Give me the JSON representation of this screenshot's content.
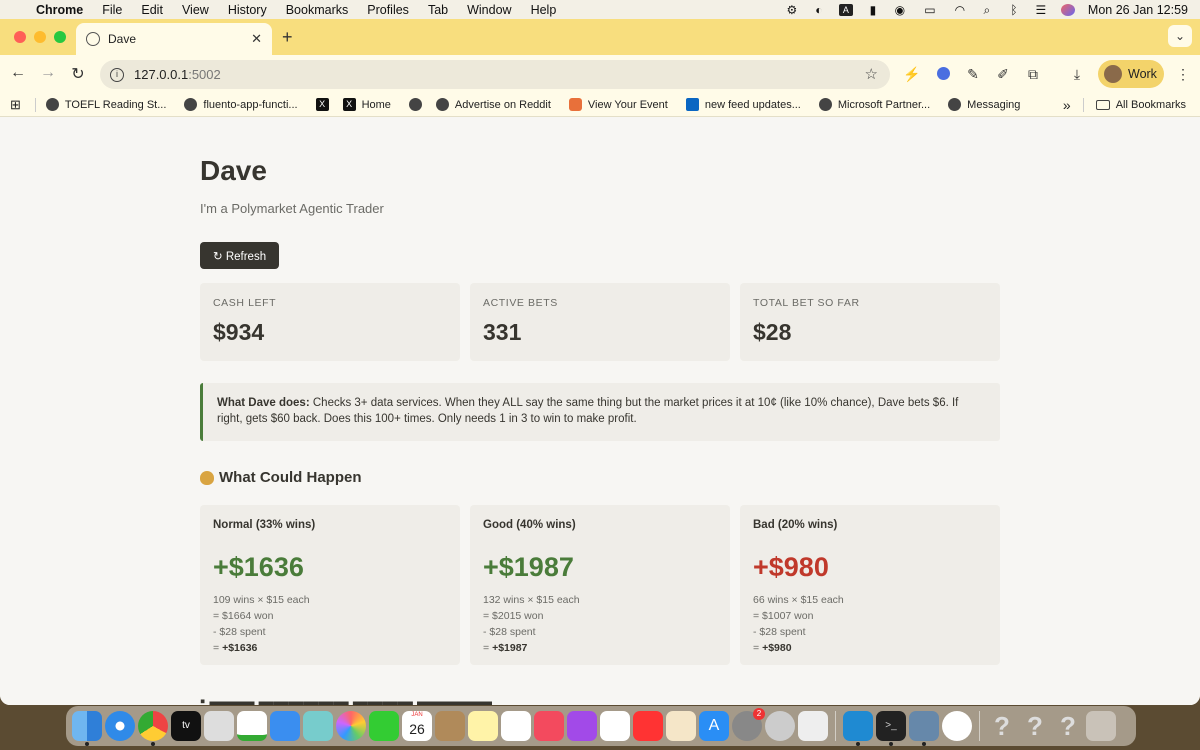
{
  "menubar": {
    "app": "Chrome",
    "items": [
      "File",
      "Edit",
      "View",
      "History",
      "Bookmarks",
      "Profiles",
      "Tab",
      "Window",
      "Help"
    ],
    "clock": "Mon 26 Jan  12:59",
    "status_letter": "A"
  },
  "browser": {
    "tab_title": "Dave",
    "url_host": "127.0.0.1",
    "url_port": ":5002",
    "profile_label": "Work",
    "bookmarks": [
      "TOEFL Reading St...",
      "fluento-app-functi...",
      "Home",
      "Advertise on Reddit",
      "View Your Event",
      "new feed updates...",
      "Microsoft Partner...",
      "Messaging"
    ],
    "all_bookmarks": "All Bookmarks",
    "overflow": "»"
  },
  "page": {
    "title": "Dave",
    "subtitle": "I'm a Polymarket Agentic Trader",
    "refresh_label": "↻ Refresh",
    "stats": [
      {
        "label": "CASH LEFT",
        "value": "$934"
      },
      {
        "label": "ACTIVE BETS",
        "value": "331"
      },
      {
        "label": "TOTAL BET SO FAR",
        "value": "$28"
      }
    ],
    "callout": {
      "lead": "What Dave does:",
      "text": " Checks 3+ data services. When they ALL say the same thing but the market prices it at 10¢ (like 10% chance), Dave bets $6. If right, gets $60 back. Does this 100+ times. Only needs 1 in 3 to win to make profit."
    },
    "scenarios_heading": "What Could Happen",
    "scenarios": [
      {
        "title": "Normal (33% wins)",
        "result": "+$1636",
        "tone": "pos",
        "line1": "109 wins × $15 each",
        "line2": "= $1664 won",
        "line3": "- $28 spent",
        "line4_prefix": "= ",
        "line4_bold": "+$1636"
      },
      {
        "title": "Good (40% wins)",
        "result": "+$1987",
        "tone": "pos",
        "line1": "132 wins × $15 each",
        "line2": "= $2015 won",
        "line3": "- $28 spent",
        "line4_prefix": "= ",
        "line4_bold": "+$1987"
      },
      {
        "title": "Bad (20% wins)",
        "result": "+$980",
        "tone": "neg",
        "line1": "66 wins × $15 each",
        "line2": "= $1007 won",
        "line3": "- $28 spent",
        "line4_prefix": "= ",
        "line4_bold": "+$980"
      }
    ],
    "colors": {
      "positive": "#4a7c3a",
      "negative": "#c0392b",
      "text": "#37352f"
    }
  },
  "dock": {
    "calendar_month": "JAN",
    "calendar_day": "26",
    "settings_badge": "2"
  }
}
